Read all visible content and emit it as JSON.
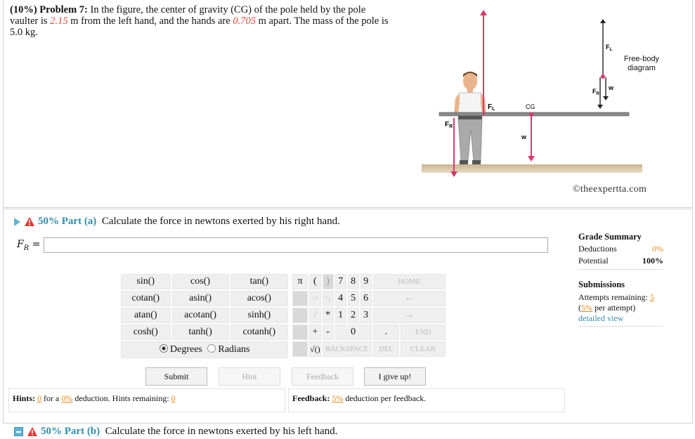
{
  "problem": {
    "prefix": "(10%) Problem 7:",
    "t1": " In the figure, the center of gravity (CG) of the pole held by the pole vaulter is ",
    "v1": "2.15",
    "t2": " m from the left hand, and the hands are ",
    "v2": "0.705",
    "t3": " m apart. The mass of the pole is 5.0 kg."
  },
  "figure": {
    "fl": "F",
    "fl_sub": "L",
    "fr": "F",
    "fr_sub": "R",
    "cg": "CG",
    "w": "w",
    "fbd": "Free-body diagram",
    "credit": "©theexpertta.com"
  },
  "part_a": {
    "pct": "50% Part (a)",
    "text": "Calculate the force in newtons exerted by his right hand.",
    "label": "F",
    "label_sub": "R",
    "eq": "=",
    "value": ""
  },
  "grade": {
    "title": "Grade Summary",
    "ded_label": "Deductions",
    "ded_val": "0%",
    "pot_label": "Potential",
    "pot_val": "100%",
    "sub_title": "Submissions",
    "att_label": "Attempts remaining:",
    "att_val": "5",
    "per_val": "5%",
    "per_text": "per attempt)",
    "detail": "detailed view"
  },
  "keypad": {
    "funcs": [
      [
        "sin()",
        "cos()",
        "tan()"
      ],
      [
        "cotan()",
        "asin()",
        "acos()"
      ],
      [
        "atan()",
        "acotan()",
        "sinh()"
      ],
      [
        "cosh()",
        "tanh()",
        "cotanh()"
      ]
    ],
    "degrees": "Degrees",
    "radians": "Radians",
    "pi": "π",
    "lp": "(",
    "rp": ")",
    "up1": "↑^",
    "up2": "^↓",
    "slash": "/",
    "star": "*",
    "plus": "+",
    "minus": "-",
    "sqrt": "√()",
    "nums": [
      [
        "7",
        "8",
        "9"
      ],
      [
        "4",
        "5",
        "6"
      ],
      [
        "1",
        "2",
        "3"
      ]
    ],
    "zero": "0",
    "dot": ".",
    "home": "HOME",
    "left": "←",
    "right": "→",
    "end": "END",
    "backspace": "BACKSPACE",
    "del": "DEL",
    "clear": "CLEAR"
  },
  "buttons": {
    "submit": "Submit",
    "hint": "Hint",
    "feedback": "Feedback",
    "giveup": "I give up!"
  },
  "hints": {
    "label": "Hints:",
    "n": "0",
    "for_a": "for a",
    "pct": "0%",
    "rest": "deduction. Hints remaining:",
    "rem": "0"
  },
  "feedback": {
    "label": "Feedback:",
    "pct": "5%",
    "rest": "deduction per feedback."
  },
  "part_b": {
    "pct": "50% Part (b)",
    "text": "Calculate the force in newtons exerted by his left hand."
  },
  "colors": {
    "accent": "#2f8fb0",
    "red_value": "#e8473a",
    "arrow": "#d9386a",
    "orange": "#e88a17"
  }
}
